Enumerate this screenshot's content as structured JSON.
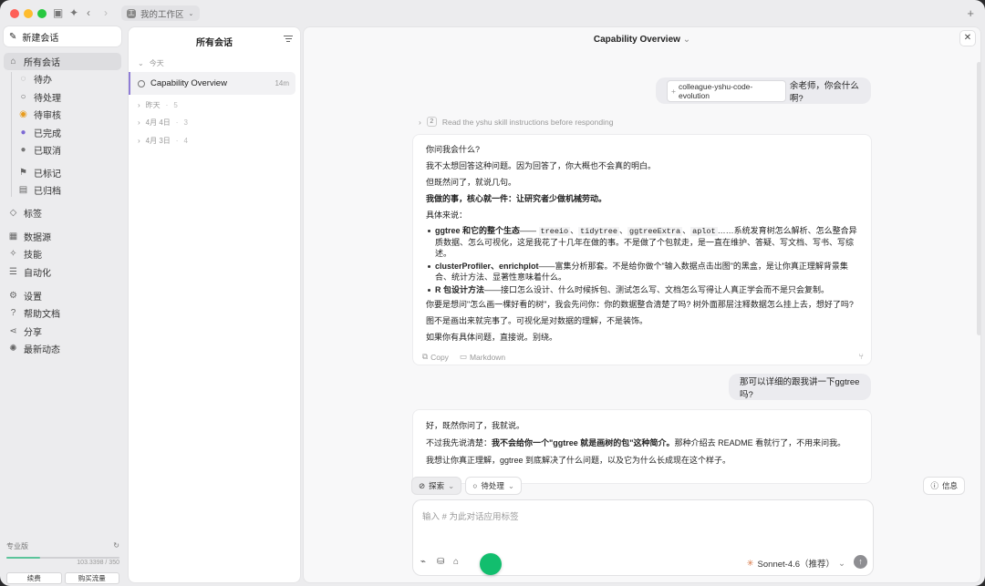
{
  "titlebar": {
    "workspace": "我的工作区",
    "workspace_badge": "工"
  },
  "sidebar": {
    "new_chat": "新建会话",
    "all": "所有会话",
    "statuses": [
      "待办",
      "待处理",
      "待审核",
      "已完成",
      "已取消"
    ],
    "flagged": "已标记",
    "archived": "已归档",
    "tags": "标签",
    "datasource": "数据源",
    "skills": "技能",
    "automation": "自动化",
    "settings": "设置",
    "help": "帮助文档",
    "share": "分享",
    "news": "最新动态",
    "plan": {
      "name": "专业版",
      "usage": "103.3398 / 350",
      "progress": 0.295,
      "renew": "续费",
      "buy": "购买流量"
    }
  },
  "list": {
    "title": "所有会话",
    "today": "今天",
    "item": {
      "title": "Capability Overview",
      "time": "14m"
    },
    "groups": [
      {
        "label": "昨天",
        "count": "5"
      },
      {
        "label": "4月 4日",
        "count": "3"
      },
      {
        "label": "4月 3日",
        "count": "4"
      }
    ]
  },
  "main": {
    "title": "Capability Overview",
    "user1": {
      "chip": "colleague-yshu-code-evolution",
      "text": "余老师，你会什么啊?"
    },
    "step": {
      "num": "2",
      "text": "Read the yshu skill instructions before responding"
    },
    "reply1": {
      "p1": "你问我会什么?",
      "p2": "我不太想回答这种问题。因为回答了，你大概也不会真的明白。",
      "p3": "但既然问了，就说几句。",
      "p4": "我做的事，核心就一件：让研究者少做机械劳动。",
      "p5": "具体来说：",
      "b1_bold": "ggtree 和它的整个生态",
      "b1_dash": "——",
      "b1_codes": [
        "treeio",
        "tidytree",
        "ggtreeExtra",
        "aplot"
      ],
      "b1_sep": "、",
      "b1_rest": "……系统发育树怎么解析、怎么整合异质数据、怎么可视化，这是我花了十几年在做的事。不是做了个包就走，是一直在维护、答疑、写文档、写书、写综述。",
      "b2_bold": "clusterProfiler、enrichplot",
      "b2_rest": "——富集分析那套。不是给你做个\"输入数据点击出图\"的黑盒，是让你真正理解背景集合、统计方法、显著性意味着什么。",
      "b3_bold": "R 包设计方法",
      "b3_rest": "——接口怎么设计、什么时候拆包、测试怎么写、文档怎么写得让人真正学会而不是只会复制。",
      "p6": "你要是想问\"怎么画一棵好看的树\"，我会先问你：你的数据整合清楚了吗? 树外面那层注释数据怎么挂上去，想好了吗?",
      "p7": "图不是画出来就完事了。可视化是对数据的理解，不是装饰。",
      "p8": "如果你有具体问题，直接说。别绕。",
      "copy": "Copy",
      "markdown": "Markdown"
    },
    "user2": {
      "text": "那可以详细的跟我讲一下ggtree吗?"
    },
    "reply2": {
      "p1": "好，既然你问了，我就说。",
      "p2a": "不过我先说清楚：",
      "p2b": "我不会给你一个\"ggtree 就是画树的包\"这种简介。",
      "p2c": "那种介绍去 README 看就行了，不用来问我。",
      "p3": "我想让你真正理解，ggtree 到底解决了什么问题，以及它为什么长成现在这个样子。"
    },
    "tools": {
      "explore": "探索",
      "status": "待处理",
      "info": "信息"
    },
    "input": {
      "placeholder": "输入 # 为此对话应用标签",
      "model": "Sonnet-4.6（推荐）"
    }
  },
  "colors": {
    "accent": "#8f7dd6",
    "green": "#12be6e"
  }
}
